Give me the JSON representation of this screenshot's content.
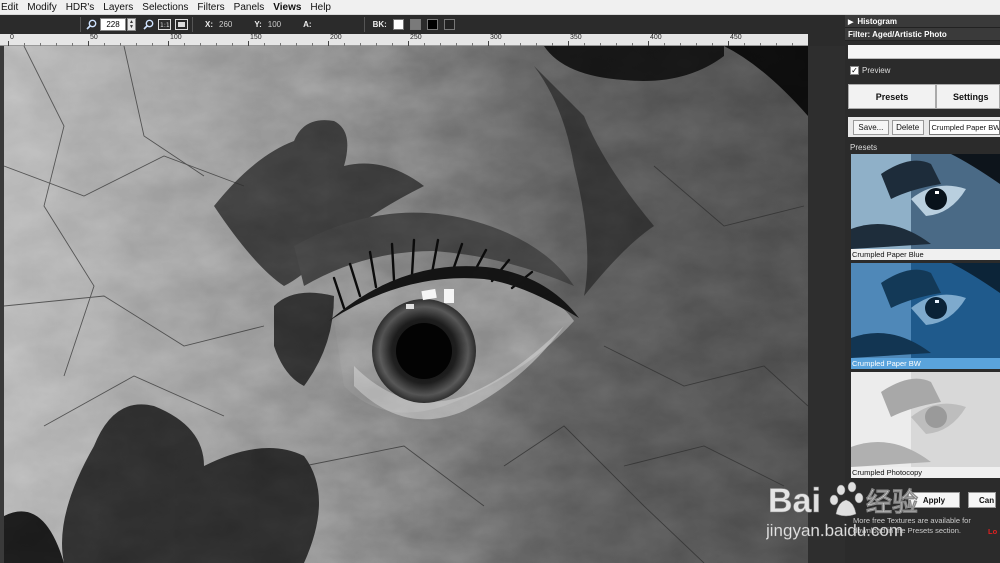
{
  "menu": {
    "items": [
      "Edit",
      "Modify",
      "HDR's",
      "Layers",
      "Selections",
      "Filters",
      "Panels",
      "Views",
      "Help"
    ],
    "active": "Views"
  },
  "toolbar": {
    "zoom_value": "228",
    "x_label": "X:",
    "x_value": "260",
    "y_label": "Y:",
    "y_value": "100",
    "a_label": "A:",
    "bk_label": "BK:",
    "bk_colors": [
      "#ffffff",
      "#7a7a7a",
      "#000000",
      "#222222"
    ],
    "fit_label": "1:1"
  },
  "ruler": {
    "labels": [
      "0",
      "50",
      "100",
      "150",
      "200",
      "250",
      "300",
      "350",
      "400",
      "450"
    ]
  },
  "panel": {
    "histogram_title": "Histogram",
    "filter_title": "Filter: Aged/Artistic Photo",
    "preview_label": "Preview",
    "preview_checked": true,
    "tabs": [
      "Presets",
      "Settings"
    ],
    "save_label": "Save...",
    "delete_label": "Delete",
    "preset_name_value": "Crumpled Paper BW",
    "presets_label": "Presets",
    "presets": [
      {
        "name": "Crumpled Paper Blue",
        "selected": false
      },
      {
        "name": "Crumpled Paper BW",
        "selected": true
      },
      {
        "name": "Crumpled Photocopy",
        "selected": false
      }
    ],
    "apply_label": "Apply",
    "cancel_label": "Can",
    "note_text": "More free Textures are available for download in the Presets section.",
    "load_label": "Lo"
  },
  "watermark": {
    "brand": "Bai",
    "brand_cn": "经验",
    "url": "jingyan.baidu.com"
  }
}
